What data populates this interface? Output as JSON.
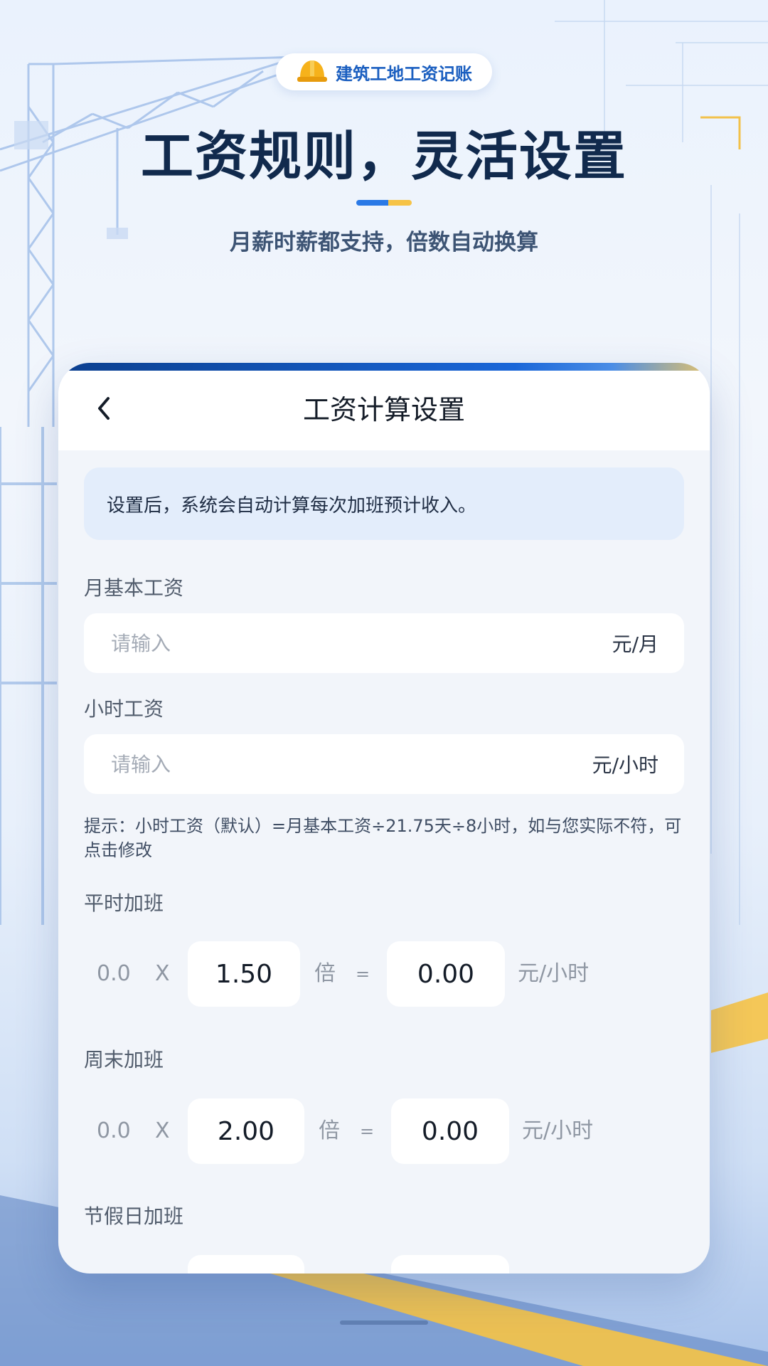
{
  "badge": {
    "label": "建筑工地工资记账",
    "icon": "hard-hat-icon"
  },
  "hero": {
    "title": "工资规则，灵活设置",
    "subtitle": "月薪时薪都支持，倍数自动换算"
  },
  "screen": {
    "nav_title": "工资计算设置",
    "notice": "设置后，系统会自动计算每次加班预计收入。",
    "monthly_wage": {
      "label": "月基本工资",
      "placeholder": "请输入",
      "unit": "元/月"
    },
    "hourly_wage": {
      "label": "小时工资",
      "placeholder": "请输入",
      "unit": "元/小时"
    },
    "hint": "提示：小时工资（默认）=月基本工资÷21.75天÷8小时，如与您实际不符，可点击修改",
    "overtime": [
      {
        "label": "平时加班",
        "base": "0.0",
        "times": "X",
        "multiplier": "1.50",
        "bei": "倍",
        "equals": "=",
        "result": "0.00",
        "unit": "元/小时"
      },
      {
        "label": "周末加班",
        "base": "0.0",
        "times": "X",
        "multiplier": "2.00",
        "bei": "倍",
        "equals": "=",
        "result": "0.00",
        "unit": "元/小时"
      },
      {
        "label": "节假日加班"
      }
    ]
  },
  "colors": {
    "accent": "#1a66d8",
    "title": "#112a4d",
    "highlight": "#f6c346"
  }
}
